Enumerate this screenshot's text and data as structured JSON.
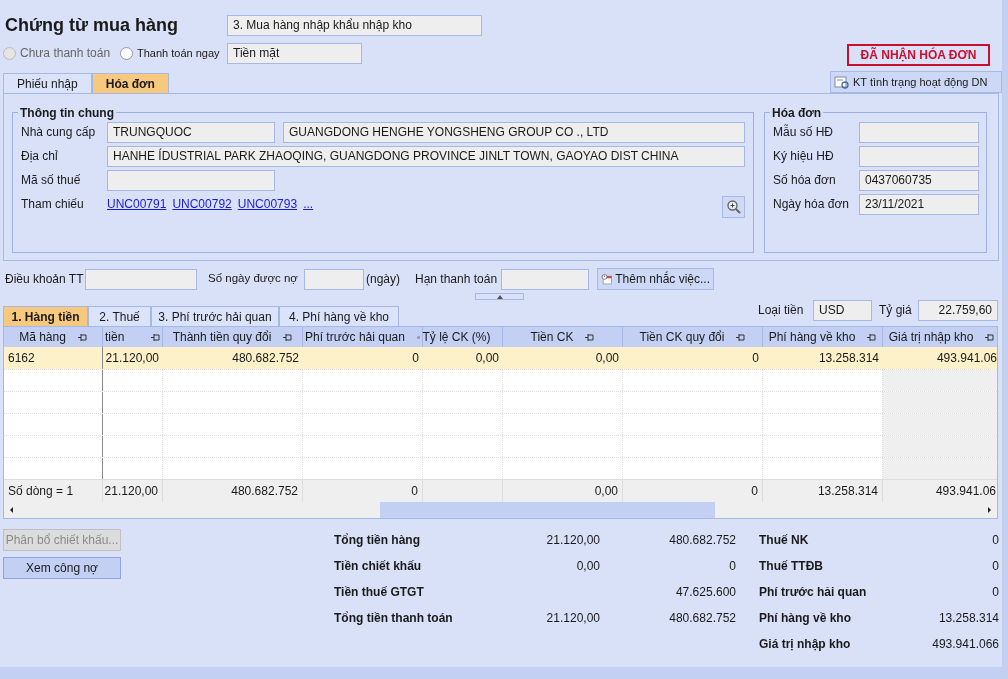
{
  "title": "Chứng từ mua hàng",
  "voucher_type": "3. Mua hàng nhập khẩu nhập kho",
  "payment_options": [
    {
      "label": "Chưa thanh toán",
      "selected": false,
      "disabled": true
    },
    {
      "label": "Thanh toán ngay",
      "selected": false,
      "disabled": false
    }
  ],
  "payment_method": "Tiền mặt",
  "invoice_status": "ĐÃ NHẬN HÓA ĐƠN",
  "tabs": [
    {
      "label": "Phiếu nhập",
      "selected": false
    },
    {
      "label": "Hóa đơn",
      "selected": true
    }
  ],
  "check_button": "KT tình trạng hoạt động DN",
  "general_info": {
    "title": "Thông tin chung",
    "supplier_label": "Nhà cung cấp",
    "supplier_code": "TRUNGQUOC",
    "supplier_name": "GUANGDONG HENGHE YONGSHENG GROUP CO ., LTD",
    "address_label": "Địa chỉ",
    "address": "HANHE ÍDUSTRIAL PARK ZHAOQING, GUANGDONG PROVINCE JINLT TOWN, GAOYAO DIST CHINA",
    "tax_code_label": "Mã số thuế",
    "reference_label": "Tham chiếu",
    "references": [
      "UNC00791",
      "UNC00792",
      "UNC00793",
      "..."
    ]
  },
  "invoice": {
    "title": "Hóa đơn",
    "fields": [
      {
        "label": "Mẫu số HĐ"
      },
      {
        "label": "Ký hiệu HĐ"
      },
      {
        "label": "Số hóa đơn",
        "value": "0437060735"
      },
      {
        "label": "Ngày hóa đơn",
        "value": "23/11/2021"
      }
    ]
  },
  "terms": {
    "payment_terms_label": "Điều khoản TT",
    "days_label": "Số ngày được nợ",
    "days_unit": "(ngày)",
    "due_label": "Hạn thanh toán",
    "reminder_button": "Thêm nhắc việc..."
  },
  "currency": {
    "label": "Loại tiền",
    "value": "USD",
    "rate_label": "Tỷ giá",
    "rate": "22.759,60"
  },
  "grid_tabs": [
    {
      "label": "1. Hàng tiền",
      "selected": true
    },
    {
      "label": "2. Thuế",
      "selected": false
    },
    {
      "label": "3. Phí trước hải quan",
      "selected": false
    },
    {
      "label": "4. Phí hàng về kho",
      "selected": false
    }
  ],
  "table": {
    "columns": [
      "Mã hàng",
      "tiền",
      "Thành tiền quy đổi",
      "Phí trước hải quan",
      "Tỷ lệ CK (%)",
      "Tiền CK",
      "Tiền CK quy đổi",
      "Phí hàng về kho",
      "Giá trị nhập kho"
    ],
    "rows": [
      [
        "6162",
        "21.120,00",
        "480.682.752",
        "0",
        "0,00",
        "0,00",
        "0",
        "13.258.314",
        "493.941.06"
      ]
    ],
    "footer": [
      {
        "kind": "text",
        "value": "Số dòng = 1"
      },
      {
        "kind": "text",
        "value": "21.120,00"
      },
      {
        "kind": "text",
        "value": "480.682.752"
      },
      {
        "kind": "text",
        "value": "0"
      },
      {
        "kind": "blank"
      },
      {
        "kind": "text",
        "value": "0,00"
      },
      {
        "kind": "text",
        "value": "0"
      },
      {
        "kind": "text",
        "value": "13.258.314"
      },
      {
        "kind": "text",
        "value": "493.941.06"
      }
    ]
  },
  "buttons": [
    {
      "label": "Phân bổ chiết khấu...",
      "disabled": true
    },
    {
      "label": "Xem công nợ",
      "disabled": false
    }
  ],
  "totals": [
    {
      "label": "Tổng tiền hàng",
      "value": "21.120,00",
      "converted": "480.682.752"
    },
    {
      "label": "Tiền chiết khấu",
      "value": "0,00",
      "converted": "0"
    },
    {
      "label": "Tiền thuế GTGT",
      "converted": "47.625.600"
    },
    {
      "label": "Tổng tiền thanh toán",
      "value": "21.120,00",
      "converted": "480.682.752"
    }
  ],
  "costs": [
    {
      "label": "Thuế NK",
      "value": "0"
    },
    {
      "label": "Thuế TTĐB",
      "value": "0"
    },
    {
      "label": "Phí trước hải quan",
      "value": "0"
    },
    {
      "label": "Phí hàng về kho",
      "value": "13.258.314"
    },
    {
      "label": "Giá trị nhập kho",
      "value": "493.941.066"
    }
  ]
}
